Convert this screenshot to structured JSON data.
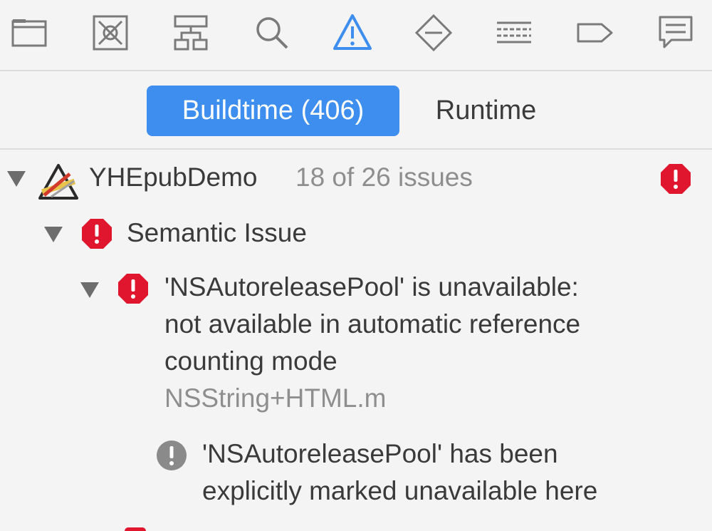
{
  "toolbar": {
    "icons": [
      "folder-icon",
      "source-control-icon",
      "hierarchy-icon",
      "search-icon",
      "issue-icon",
      "test-icon",
      "debug-icon",
      "breakpoint-icon",
      "report-icon"
    ],
    "active_icon": "issue-icon",
    "accent_color": "#3e8ef0"
  },
  "segments": {
    "buildtime_label": "Buildtime (406)",
    "runtime_label": "Runtime",
    "selected": "Buildtime (406)"
  },
  "tree": {
    "project": {
      "name": "YHEpubDemo",
      "count": "18 of 26 issues"
    },
    "category": {
      "label": "Semantic Issue"
    },
    "issue": {
      "line1": "'NSAutoreleasePool' is unavailable:",
      "line2": "not available in automatic reference",
      "line3": "counting mode",
      "file": "NSString+HTML.m"
    },
    "note": {
      "line1": "'NSAutoreleasePool' has been",
      "line2": "explicitly marked unavailable here"
    }
  },
  "colors": {
    "error": "#e0162f",
    "note": "#8a8a8a"
  }
}
